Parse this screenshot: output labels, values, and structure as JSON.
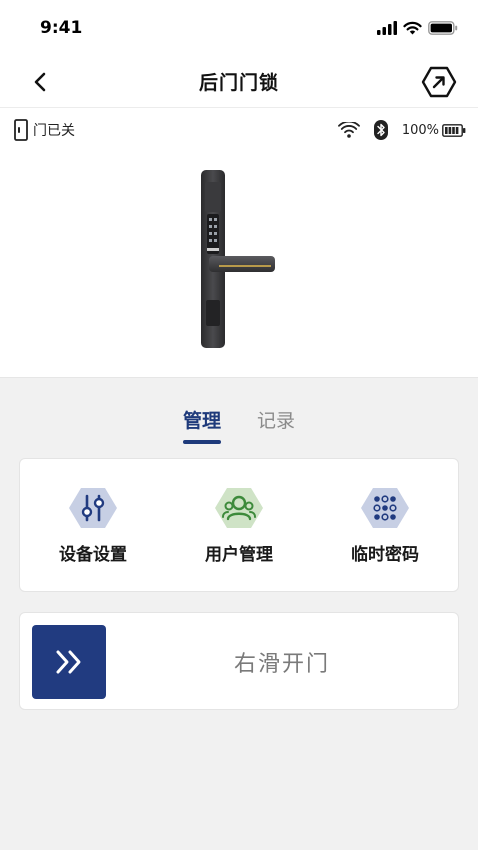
{
  "status_bar": {
    "time": "9:41"
  },
  "nav": {
    "title": "后门门锁"
  },
  "device": {
    "door_state": "门已关",
    "battery": "100%"
  },
  "tabs": [
    {
      "label": "管理",
      "active": true
    },
    {
      "label": "记录",
      "active": false
    }
  ],
  "tools": [
    {
      "label": "设备设置",
      "icon": "sliders-icon"
    },
    {
      "label": "用户管理",
      "icon": "users-icon"
    },
    {
      "label": "临时密码",
      "icon": "keypad-icon"
    }
  ],
  "slider": {
    "label": "右滑开门"
  },
  "colors": {
    "accent": "#1e3a7b",
    "user_icon_bg": "#cfe3c6",
    "tool_icon_bg": "#c7cfe4"
  }
}
